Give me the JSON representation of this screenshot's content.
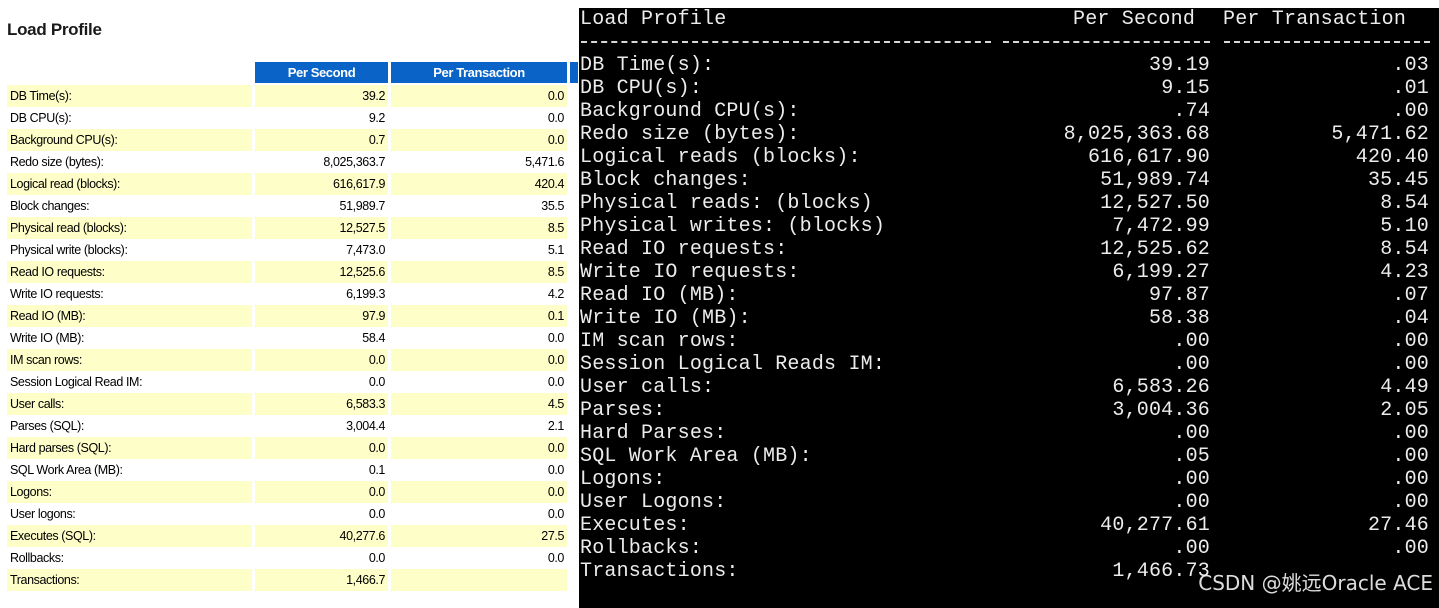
{
  "left": {
    "title": "Load Profile",
    "headers": {
      "per_second": "Per Second",
      "per_transaction": "Per Transaction"
    },
    "rows": [
      {
        "name": "DB Time(s):",
        "ps": "39.2",
        "pt": "0.0"
      },
      {
        "name": "DB CPU(s):",
        "ps": "9.2",
        "pt": "0.0"
      },
      {
        "name": "Background CPU(s):",
        "ps": "0.7",
        "pt": "0.0"
      },
      {
        "name": "Redo size (bytes):",
        "ps": "8,025,363.7",
        "pt": "5,471.6"
      },
      {
        "name": "Logical read (blocks):",
        "ps": "616,617.9",
        "pt": "420.4"
      },
      {
        "name": "Block changes:",
        "ps": "51,989.7",
        "pt": "35.5"
      },
      {
        "name": "Physical read (blocks):",
        "ps": "12,527.5",
        "pt": "8.5"
      },
      {
        "name": "Physical write (blocks):",
        "ps": "7,473.0",
        "pt": "5.1"
      },
      {
        "name": "Read IO requests:",
        "ps": "12,525.6",
        "pt": "8.5"
      },
      {
        "name": "Write IO requests:",
        "ps": "6,199.3",
        "pt": "4.2"
      },
      {
        "name": "Read IO (MB):",
        "ps": "97.9",
        "pt": "0.1"
      },
      {
        "name": "Write IO (MB):",
        "ps": "58.4",
        "pt": "0.0"
      },
      {
        "name": "IM scan rows:",
        "ps": "0.0",
        "pt": "0.0"
      },
      {
        "name": "Session Logical Read IM:",
        "ps": "0.0",
        "pt": "0.0"
      },
      {
        "name": "User calls:",
        "ps": "6,583.3",
        "pt": "4.5"
      },
      {
        "name": "Parses (SQL):",
        "ps": "3,004.4",
        "pt": "2.1"
      },
      {
        "name": "Hard parses (SQL):",
        "ps": "0.0",
        "pt": "0.0"
      },
      {
        "name": "SQL Work Area (MB):",
        "ps": "0.1",
        "pt": "0.0"
      },
      {
        "name": "Logons:",
        "ps": "0.0",
        "pt": "0.0"
      },
      {
        "name": "User logons:",
        "ps": "0.0",
        "pt": "0.0"
      },
      {
        "name": "Executes (SQL):",
        "ps": "40,277.6",
        "pt": "27.5"
      },
      {
        "name": "Rollbacks:",
        "ps": "0.0",
        "pt": "0.0"
      },
      {
        "name": "Transactions:",
        "ps": "1,466.7",
        "pt": ""
      }
    ]
  },
  "right": {
    "title": "Load Profile",
    "headers": {
      "per_second": "Per Second",
      "per_transaction": "Per Transaction"
    },
    "rows": [
      {
        "name": "DB Time(s):",
        "ps": "39.19",
        "pt": ".03"
      },
      {
        "name": "DB CPU(s):",
        "ps": "9.15",
        "pt": ".01"
      },
      {
        "name": "Background CPU(s):",
        "ps": ".74",
        "pt": ".00"
      },
      {
        "name": "Redo size (bytes):",
        "ps": "8,025,363.68",
        "pt": "5,471.62"
      },
      {
        "name": "Logical reads (blocks):",
        "ps": "616,617.90",
        "pt": "420.40"
      },
      {
        "name": "Block changes:",
        "ps": "51,989.74",
        "pt": "35.45"
      },
      {
        "name": "Physical reads: (blocks)",
        "ps": "12,527.50",
        "pt": "8.54"
      },
      {
        "name": "Physical writes: (blocks)",
        "ps": "7,472.99",
        "pt": "5.10"
      },
      {
        "name": "Read IO requests:",
        "ps": "12,525.62",
        "pt": "8.54"
      },
      {
        "name": "Write IO requests:",
        "ps": "6,199.27",
        "pt": "4.23"
      },
      {
        "name": "Read IO (MB):",
        "ps": "97.87",
        "pt": ".07"
      },
      {
        "name": "Write IO (MB):",
        "ps": "58.38",
        "pt": ".04"
      },
      {
        "name": "IM scan rows:",
        "ps": ".00",
        "pt": ".00"
      },
      {
        "name": "Session Logical Reads IM:",
        "ps": ".00",
        "pt": ".00"
      },
      {
        "name": "User calls:",
        "ps": "6,583.26",
        "pt": "4.49"
      },
      {
        "name": "Parses:",
        "ps": "3,004.36",
        "pt": "2.05"
      },
      {
        "name": "Hard Parses:",
        "ps": ".00",
        "pt": ".00"
      },
      {
        "name": "SQL Work Area (MB):",
        "ps": ".05",
        "pt": ".00"
      },
      {
        "name": "Logons:",
        "ps": ".00",
        "pt": ".00"
      },
      {
        "name": "User Logons:",
        "ps": ".00",
        "pt": ".00"
      },
      {
        "name": "Executes:",
        "ps": "40,277.61",
        "pt": "27.46"
      },
      {
        "name": "Rollbacks:",
        "ps": ".00",
        "pt": ".00"
      },
      {
        "name": "Transactions:",
        "ps": "1,466.73",
        "pt": ""
      }
    ]
  },
  "watermark": "CSDN @姚远Oracle ACE"
}
